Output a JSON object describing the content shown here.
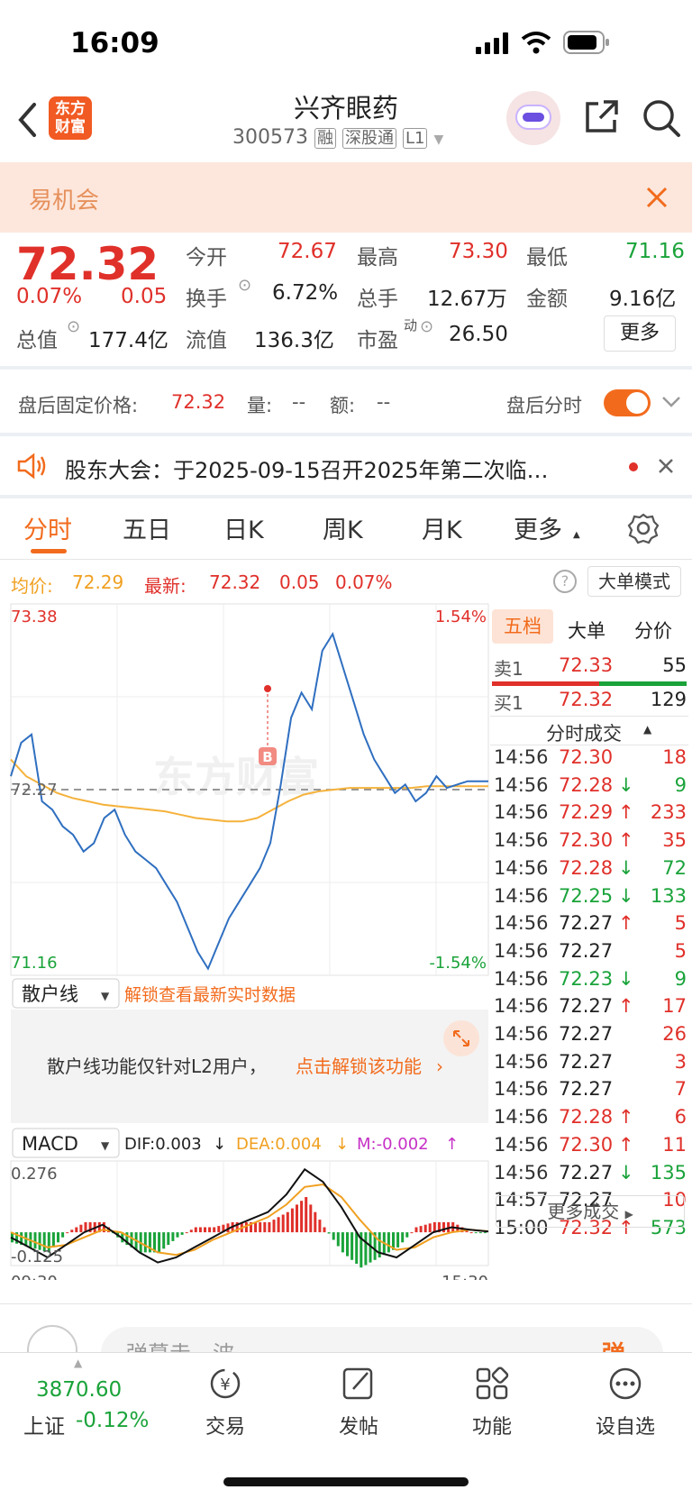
{
  "status_bar": {
    "time": "16:09"
  },
  "header": {
    "title": "兴齐眼药",
    "code": "300573",
    "tag1": "融",
    "tag2": "深股通",
    "tag3": "L1",
    "logo_line1": "东方",
    "logo_line2": "财富"
  },
  "opportunity": {
    "text": "易机会"
  },
  "quote": {
    "price": "72.32",
    "change_pct": "0.07%",
    "change": "0.05",
    "open_label": "今开",
    "open": "72.67",
    "high_label": "最高",
    "high": "73.30",
    "low_label": "最低",
    "low": "71.16",
    "turnover_label": "换手",
    "turnover": "6.72%",
    "volume_label": "总手",
    "volume": "12.67万",
    "amount_label": "金额",
    "amount": "9.16亿",
    "mktcap_label": "总值",
    "mktcap": "177.4亿",
    "float_label": "流值",
    "float": "136.3亿",
    "pe_label": "市盈",
    "pe_sup": "动",
    "pe": "26.50",
    "more": "更多"
  },
  "after_hours": {
    "label": "盘后固定价格:",
    "price": "72.32",
    "vol_label": "量:",
    "vol": "--",
    "amt_label": "额:",
    "amt": "--",
    "toggle_label": "盘后分时"
  },
  "notice": {
    "text": "股东大会：于2025-09-15召开2025年第二次临…"
  },
  "tabs": [
    "分时",
    "五日",
    "日K",
    "周K",
    "月K",
    "更多"
  ],
  "info": {
    "avg_label": "均价:",
    "avg": "72.29",
    "latest_label": "最新:",
    "latest": "72.32",
    "chg": "0.05",
    "pct": "0.07%",
    "big_mode": "大单模式"
  },
  "chart_labels": {
    "top_price": "73.38",
    "bottom_price": "71.16",
    "top_pct": "1.54%",
    "bottom_pct": "-1.54%",
    "mid_price": "72.27",
    "b_marker": "B",
    "watermark": "东方财富",
    "time_start": "09:30",
    "time_end": "15:30"
  },
  "retail": {
    "select": "散户线",
    "link": "解锁查看最新实时数据",
    "msg": "散户线功能仅针对L2用户，",
    "unlock": "点击解锁该功能"
  },
  "macd": {
    "select": "MACD",
    "dif": "DIF:0.003",
    "dea": "DEA:0.004",
    "m": "M:-0.002",
    "top": "0.276",
    "bottom": "-0.125"
  },
  "orderbook": {
    "tabs": [
      "五档",
      "大单",
      "分价"
    ],
    "sell_label": "卖1",
    "sell_price": "72.33",
    "sell_vol": "55",
    "buy_label": "买1",
    "buy_price": "72.32",
    "buy_vol": "129",
    "trades_title": "分时成交",
    "more_trades": "更多成交"
  },
  "trades": [
    {
      "t": "14:56",
      "p": "72.30",
      "d": "",
      "v": "18",
      "pc": "red",
      "vc": "red"
    },
    {
      "t": "14:56",
      "p": "72.28",
      "d": "↓",
      "v": "9",
      "pc": "red",
      "vc": "green"
    },
    {
      "t": "14:56",
      "p": "72.29",
      "d": "↑",
      "v": "233",
      "pc": "red",
      "vc": "red"
    },
    {
      "t": "14:56",
      "p": "72.30",
      "d": "↑",
      "v": "35",
      "pc": "red",
      "vc": "red"
    },
    {
      "t": "14:56",
      "p": "72.28",
      "d": "↓",
      "v": "72",
      "pc": "red",
      "vc": "green"
    },
    {
      "t": "14:56",
      "p": "72.25",
      "d": "↓",
      "v": "133",
      "pc": "green",
      "vc": "green"
    },
    {
      "t": "14:56",
      "p": "72.27",
      "d": "↑",
      "v": "5",
      "pc": "black",
      "vc": "red"
    },
    {
      "t": "14:56",
      "p": "72.27",
      "d": "",
      "v": "5",
      "pc": "black",
      "vc": "red"
    },
    {
      "t": "14:56",
      "p": "72.23",
      "d": "↓",
      "v": "9",
      "pc": "green",
      "vc": "green"
    },
    {
      "t": "14:56",
      "p": "72.27",
      "d": "↑",
      "v": "17",
      "pc": "black",
      "vc": "red"
    },
    {
      "t": "14:56",
      "p": "72.27",
      "d": "",
      "v": "26",
      "pc": "black",
      "vc": "red"
    },
    {
      "t": "14:56",
      "p": "72.27",
      "d": "",
      "v": "3",
      "pc": "black",
      "vc": "red"
    },
    {
      "t": "14:56",
      "p": "72.27",
      "d": "",
      "v": "7",
      "pc": "black",
      "vc": "red"
    },
    {
      "t": "14:56",
      "p": "72.28",
      "d": "↑",
      "v": "6",
      "pc": "red",
      "vc": "red"
    },
    {
      "t": "14:56",
      "p": "72.30",
      "d": "↑",
      "v": "11",
      "pc": "red",
      "vc": "red"
    },
    {
      "t": "14:56",
      "p": "72.27",
      "d": "↓",
      "v": "135",
      "pc": "black",
      "vc": "green"
    },
    {
      "t": "14:57",
      "p": "72.27",
      "d": "",
      "v": "10",
      "pc": "black",
      "vc": "red"
    },
    {
      "t": "15:00",
      "p": "72.32",
      "d": "↑",
      "v": "573",
      "pc": "red",
      "vc": "green"
    }
  ],
  "comment": {
    "placeholder": "弹幕走一波",
    "send": "弹"
  },
  "bottom_nav": {
    "index_value": "3870.60",
    "index_name": "上证",
    "index_pct": "-0.12%",
    "items": [
      "交易",
      "发帖",
      "功能",
      "设自选"
    ]
  },
  "colors": {
    "up": "#e0302a",
    "down": "#1aa33a",
    "accent": "#f26b1d",
    "price_line": "#2f6fc0",
    "avg_line": "#f5b23c"
  },
  "chart_data": {
    "type": "line",
    "ylim": [
      71.16,
      73.38
    ],
    "prev_close": 72.27,
    "price": [
      72.35,
      72.55,
      72.6,
      72.2,
      72.15,
      72.05,
      72.0,
      71.9,
      71.95,
      72.1,
      72.15,
      72.0,
      71.9,
      71.85,
      71.8,
      71.7,
      71.6,
      71.45,
      71.3,
      71.2,
      71.35,
      71.5,
      71.6,
      71.7,
      71.8,
      71.95,
      72.3,
      72.7,
      72.85,
      72.75,
      73.1,
      73.2,
      73.0,
      72.8,
      72.6,
      72.45,
      72.35,
      72.25,
      72.3,
      72.2,
      72.25,
      72.35,
      72.28,
      72.3,
      72.32,
      72.32,
      72.32
    ],
    "avg": [
      72.45,
      72.35,
      72.3,
      72.25,
      72.22,
      72.2,
      72.18,
      72.17,
      72.16,
      72.15,
      72.14,
      72.12,
      72.1,
      72.09,
      72.08,
      72.08,
      72.1,
      72.15,
      72.2,
      72.24,
      72.26,
      72.27,
      72.28,
      72.28,
      72.28,
      72.28,
      72.28,
      72.29,
      72.29,
      72.29,
      72.29,
      72.29
    ],
    "macd_dif": [
      -0.02,
      -0.06,
      -0.1,
      -0.05,
      0.0,
      0.03,
      -0.02,
      -0.08,
      -0.12,
      -0.1,
      -0.06,
      -0.02,
      0.02,
      0.05,
      0.08,
      0.15,
      0.25,
      0.2,
      0.1,
      -0.02,
      -0.08,
      -0.1,
      -0.05,
      0.0,
      0.02,
      0.01,
      0.003
    ],
    "macd_dea": [
      0.0,
      -0.03,
      -0.06,
      -0.05,
      -0.02,
      0.01,
      0.0,
      -0.04,
      -0.08,
      -0.09,
      -0.07,
      -0.03,
      0.0,
      0.03,
      0.06,
      0.11,
      0.18,
      0.19,
      0.14,
      0.05,
      -0.03,
      -0.07,
      -0.06,
      -0.02,
      0.0,
      0.01,
      0.004
    ],
    "macd_ylim": [
      -0.125,
      0.276
    ]
  }
}
